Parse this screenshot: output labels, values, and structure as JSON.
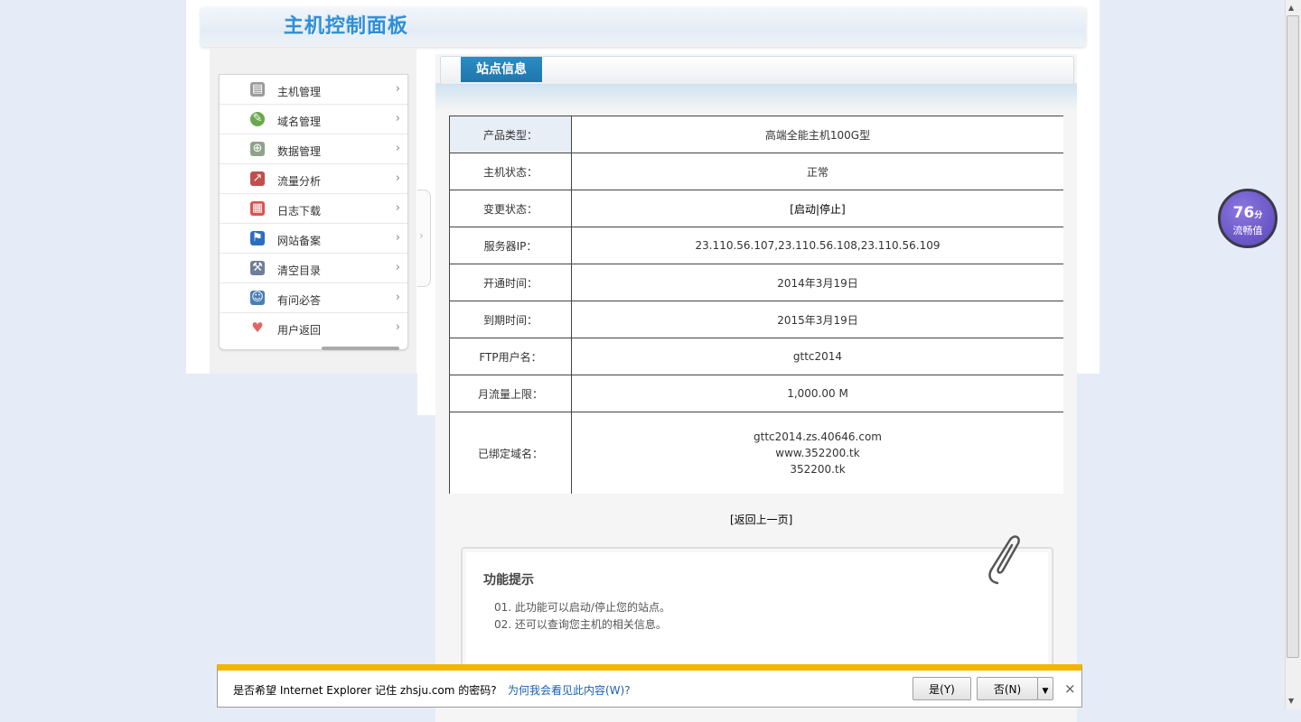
{
  "header": {
    "title": "主机控制面板"
  },
  "sidebar": {
    "items": [
      {
        "label": "主机管理",
        "icon": "server-icon",
        "color": "#8a8a8a"
      },
      {
        "label": "域名管理",
        "icon": "globe-icon",
        "color": "#6aa84f"
      },
      {
        "label": "数据管理",
        "icon": "database-icon",
        "color": "#7f8f7a"
      },
      {
        "label": "流量分析",
        "icon": "chart-icon",
        "color": "#c0504d"
      },
      {
        "label": "日志下载",
        "icon": "calendar-icon",
        "color": "#d9534f"
      },
      {
        "label": "网站备案",
        "icon": "flag-icon",
        "color": "#2a6fbf"
      },
      {
        "label": "清空目录",
        "icon": "wrench-icon",
        "color": "#6f7f99"
      },
      {
        "label": "有问必答",
        "icon": "user-support-icon",
        "color": "#4a7fb5"
      },
      {
        "label": "用户返回",
        "icon": "heart-icon",
        "color": "#e06666"
      }
    ]
  },
  "main": {
    "tab": "站点信息",
    "rows": [
      {
        "label": "产品类型：",
        "value": "高端全能主机100G型"
      },
      {
        "label": "主机状态：",
        "value": "正常"
      },
      {
        "label": "变更状态：",
        "value": "[启动|停止]"
      },
      {
        "label": "服务器IP：",
        "value": "23.110.56.107,23.110.56.108,23.110.56.109"
      },
      {
        "label": "开通时间：",
        "value": "2014年3月19日"
      },
      {
        "label": "到期时间：",
        "value": "2015年3月19日"
      },
      {
        "label": "FTP用户名：",
        "value": "gttc2014"
      },
      {
        "label": "月流量上限：",
        "value": "1,000.00 M"
      }
    ],
    "domains": {
      "label": "已绑定域名：",
      "values": [
        "gttc2014.zs.40646.com",
        "www.352200.tk",
        "352200.tk"
      ]
    },
    "back_link": "[返回上一页]",
    "tips": {
      "title": "功能提示",
      "items": [
        "01.  此功能可以启动/停止您的站点。",
        "02.  还可以查询您主机的相关信息。"
      ]
    }
  },
  "speed_widget": {
    "score": "76",
    "unit": "分",
    "label": "流畅值"
  },
  "ie_bar": {
    "message": "是否希望 Internet Explorer 记住 zhsju.com 的密码?",
    "link": "为何我会看见此内容(W)?",
    "yes": "是(Y)",
    "no": "否(N)",
    "close": "×"
  }
}
